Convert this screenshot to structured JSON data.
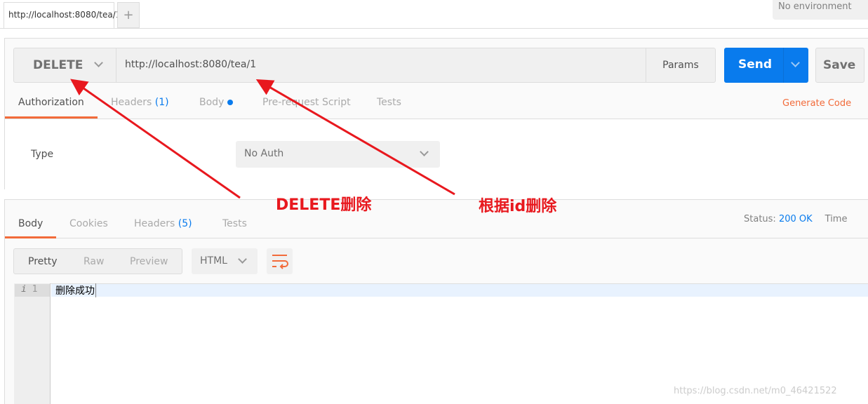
{
  "tabs": {
    "active": "http://localhost:8080/tea/1",
    "add": "+"
  },
  "environment": "No environment",
  "request": {
    "method": "DELETE",
    "url": "http://localhost:8080/tea/1",
    "params": "Params",
    "send": "Send",
    "save": "Save",
    "tabs": [
      {
        "label": "Authorization"
      },
      {
        "label": "Headers",
        "count": "(1)"
      },
      {
        "label": "Body"
      },
      {
        "label": "Pre-request Script"
      },
      {
        "label": "Tests"
      }
    ],
    "generate": "Generate Code"
  },
  "auth": {
    "type_label": "Type",
    "type_value": "No Auth"
  },
  "response": {
    "tabs": [
      {
        "label": "Body"
      },
      {
        "label": "Cookies"
      },
      {
        "label": "Headers",
        "count": "(5)"
      },
      {
        "label": "Tests"
      }
    ],
    "status_label": "Status:",
    "status_value": "200 OK",
    "time_label": "Time",
    "views": [
      "Pretty",
      "Raw",
      "Preview"
    ],
    "format": "HTML",
    "lines": [
      {
        "num": "1",
        "text": "删除成功"
      }
    ]
  },
  "annotations": {
    "method": "DELETE删除",
    "url": "根据id删除"
  },
  "watermark": "https://blog.csdn.net/m0_46421522",
  "colors": {
    "accent": "#f26b3a",
    "send": "#097bed",
    "link": "#097bed",
    "annotation": "#e8181e"
  }
}
